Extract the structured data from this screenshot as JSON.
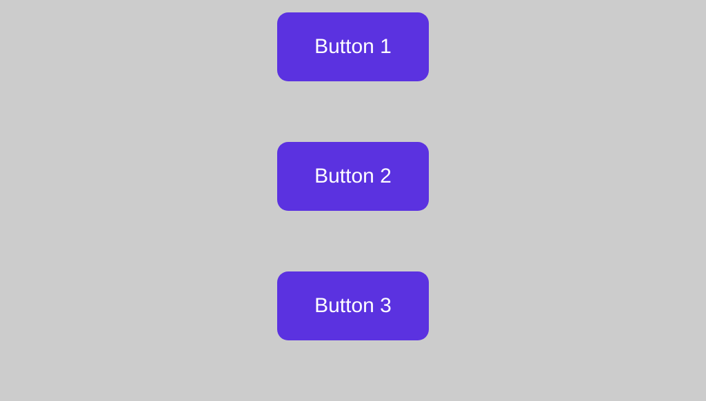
{
  "buttons": [
    {
      "label": "Button 1"
    },
    {
      "label": "Button 2"
    },
    {
      "label": "Button 3"
    }
  ],
  "colors": {
    "button_bg": "#5b32e0",
    "button_fg": "#ffffff",
    "page_bg": "#cccccc"
  }
}
